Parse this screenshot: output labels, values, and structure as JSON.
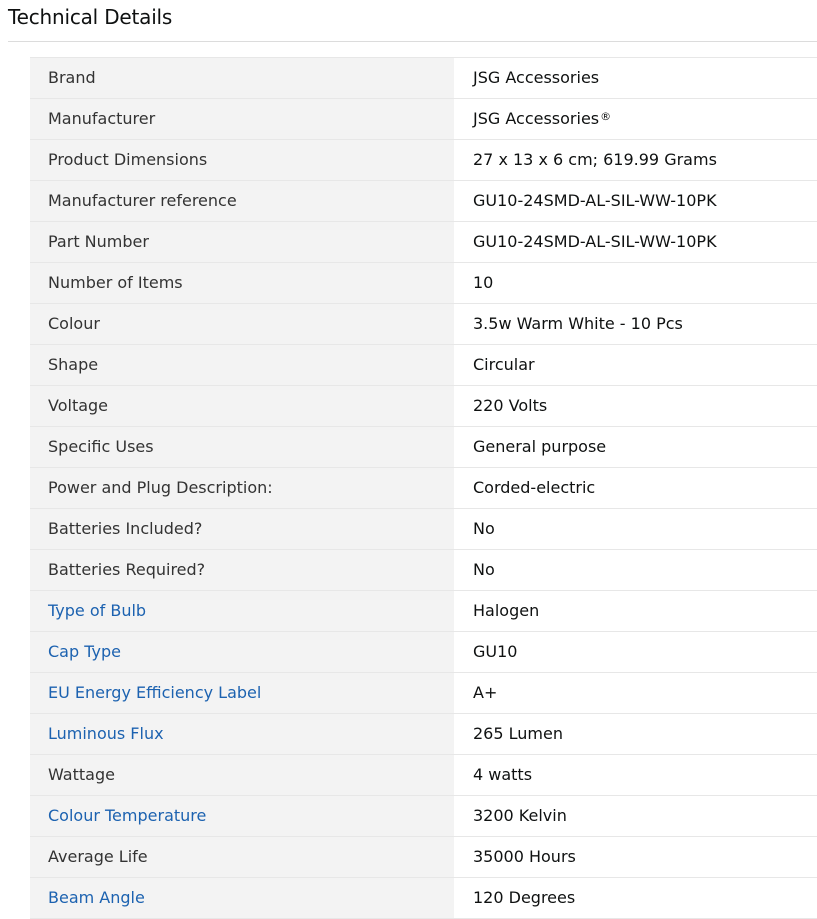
{
  "section": {
    "title": "Technical Details"
  },
  "colors": {
    "label_bg": "#f3f3f3",
    "link": "#1c62b0",
    "border": "#e7e7e7"
  },
  "rows": [
    {
      "label": "Brand",
      "value": "JSG Accessories",
      "is_link": false
    },
    {
      "label": "Manufacturer",
      "value": "JSG Accessories",
      "value_suffix": "®",
      "is_link": false
    },
    {
      "label": "Product Dimensions",
      "value": "27 x 13 x 6 cm; 619.99 Grams",
      "is_link": false
    },
    {
      "label": "Manufacturer reference",
      "value": "GU10-24SMD-AL-SIL-WW-10PK",
      "is_link": false
    },
    {
      "label": "Part Number",
      "value": "GU10-24SMD-AL-SIL-WW-10PK",
      "is_link": false
    },
    {
      "label": "Number of Items",
      "value": "10",
      "is_link": false
    },
    {
      "label": "Colour",
      "value": "3.5w Warm White - 10 Pcs",
      "is_link": false
    },
    {
      "label": "Shape",
      "value": "Circular",
      "is_link": false
    },
    {
      "label": "Voltage",
      "value": "220 Volts",
      "is_link": false
    },
    {
      "label": "Specific Uses",
      "value": "General purpose",
      "is_link": false
    },
    {
      "label": "Power and Plug Description:",
      "value": "Corded-electric",
      "is_link": false
    },
    {
      "label": "Batteries Included?",
      "value": "No",
      "is_link": false
    },
    {
      "label": "Batteries Required?",
      "value": "No",
      "is_link": false
    },
    {
      "label": "Type of Bulb",
      "value": "Halogen",
      "is_link": true
    },
    {
      "label": "Cap Type",
      "value": "GU10",
      "is_link": true
    },
    {
      "label": "EU Energy Efficiency Label",
      "value": "A+",
      "is_link": true
    },
    {
      "label": "Luminous Flux",
      "value": "265 Lumen",
      "is_link": true
    },
    {
      "label": "Wattage",
      "value": "4 watts",
      "is_link": false
    },
    {
      "label": "Colour Temperature",
      "value": "3200 Kelvin",
      "is_link": true
    },
    {
      "label": "Average Life",
      "value": "35000 Hours",
      "is_link": false
    },
    {
      "label": "Beam Angle",
      "value": "120 Degrees",
      "is_link": true
    }
  ]
}
